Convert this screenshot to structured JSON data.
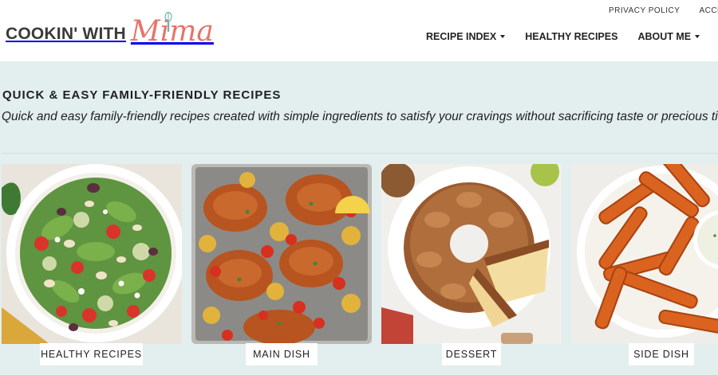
{
  "header": {
    "utility_nav": [
      "PRIVACY POLICY",
      "ACCESSI"
    ],
    "logo": {
      "text": "COOKIN' WITH",
      "script": "Mima"
    },
    "main_nav": {
      "recipe_index": "RECIPE INDEX",
      "healthy_recipes": "HEALTHY RECIPES",
      "about_me": "ABOUT ME"
    }
  },
  "section": {
    "title": "QUICK & EASY FAMILY-FRIENDLY RECIPES",
    "description": "Quick and easy family-friendly recipes created with simple ingredients to satisfy your cravings without sacrificing taste or precious time."
  },
  "cards": [
    {
      "label": "HEALTHY RECIPES"
    },
    {
      "label": "MAIN DISH"
    },
    {
      "label": "DESSERT"
    },
    {
      "label": "SIDE DISH"
    }
  ],
  "colors": {
    "band": "#e3eeee",
    "logo_script": "#e5756c",
    "text": "#222222"
  }
}
